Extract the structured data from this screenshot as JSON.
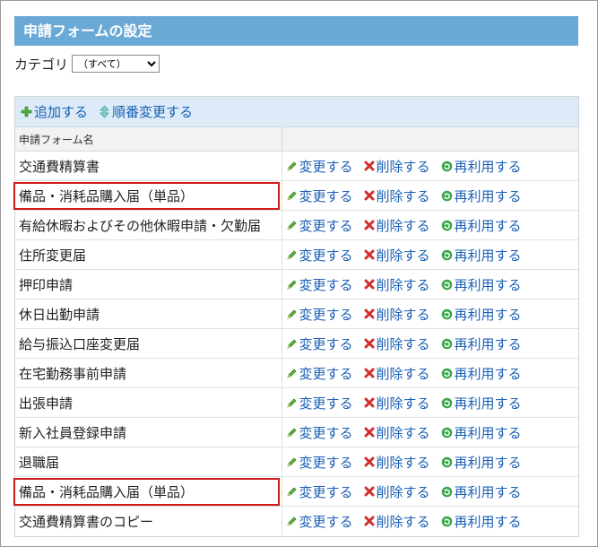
{
  "header": {
    "title": "申請フォームの設定"
  },
  "category": {
    "label": "カテゴリ",
    "selected": "（すべて）"
  },
  "toolbar": {
    "add_label": "追加する",
    "reorder_label": "順番変更する"
  },
  "table": {
    "column_header": "申請フォーム名",
    "action_labels": {
      "edit": "変更する",
      "delete": "削除する",
      "reuse": "再利用する"
    },
    "rows": [
      {
        "name": "交通費精算書",
        "highlighted": false
      },
      {
        "name": "備品・消耗品購入届（単品）",
        "highlighted": true
      },
      {
        "name": "有給休暇およびその他休暇申請・欠勤届",
        "highlighted": false
      },
      {
        "name": "住所変更届",
        "highlighted": false
      },
      {
        "name": "押印申請",
        "highlighted": false
      },
      {
        "name": "休日出勤申請",
        "highlighted": false
      },
      {
        "name": "給与振込口座変更届",
        "highlighted": false
      },
      {
        "name": "在宅勤務事前申請",
        "highlighted": false
      },
      {
        "name": "出張申請",
        "highlighted": false
      },
      {
        "name": "新入社員登録申請",
        "highlighted": false
      },
      {
        "name": "退職届",
        "highlighted": false
      },
      {
        "name": "備品・消耗品購入届（単品）",
        "highlighted": true
      },
      {
        "name": "交通費精算書のコピー",
        "highlighted": false
      }
    ]
  },
  "colors": {
    "accent": "#6aa9d6",
    "link": "#1a5fb4",
    "highlight": "#d11a1a",
    "toolbar_bg": "#dcebf7"
  }
}
